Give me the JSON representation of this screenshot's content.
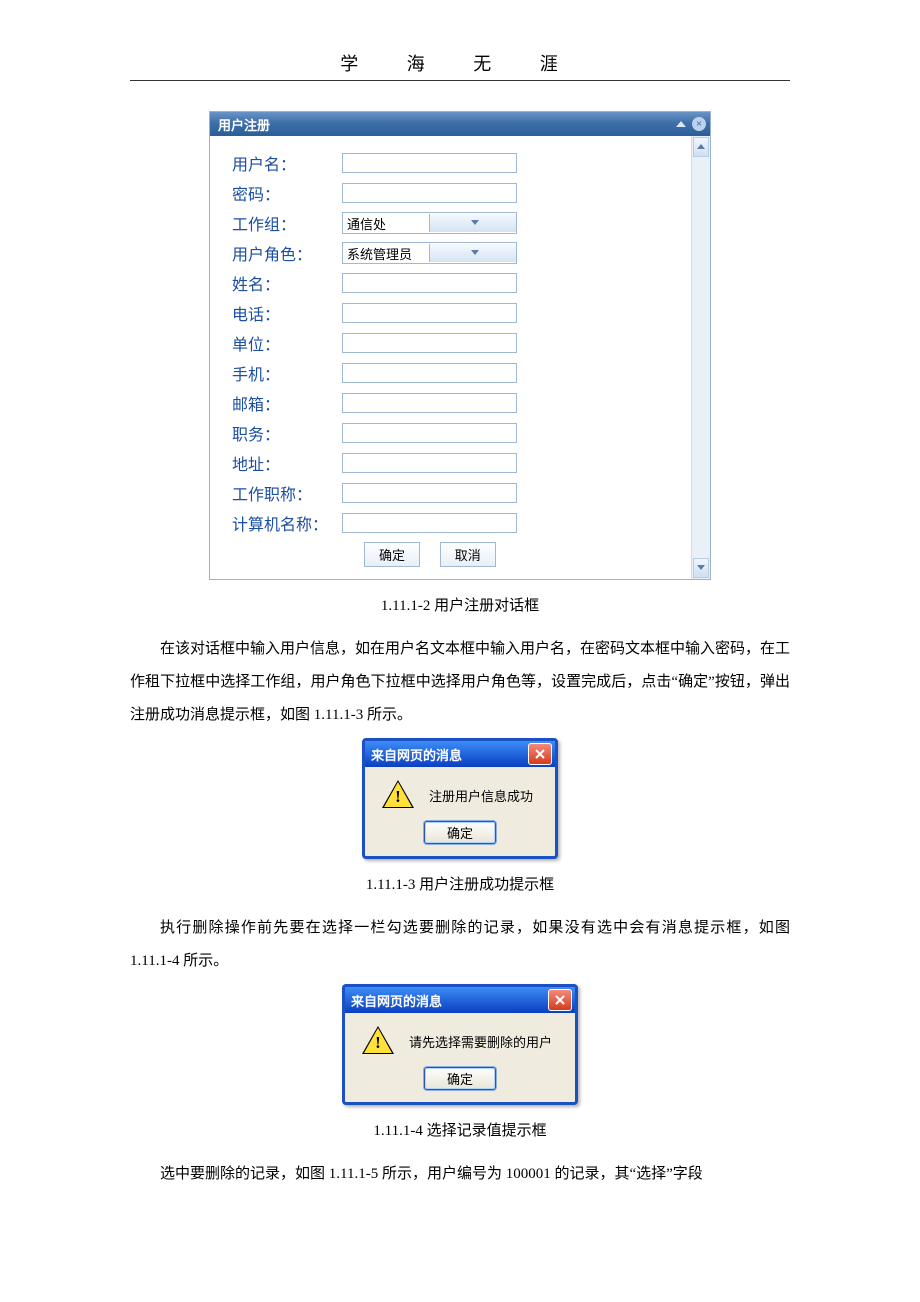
{
  "page_header": "学 海 无 涯",
  "dialog1": {
    "title": "用户注册",
    "fields": {
      "username": "用户名：",
      "password": "密码：",
      "workgroup": "工作组：",
      "workgroup_value": "通信处",
      "role": "用户角色：",
      "role_value": "系统管理员",
      "realname": "姓名：",
      "phone": "电话：",
      "unit": "单位：",
      "mobile": "手机：",
      "email": "邮箱：",
      "position": "职务：",
      "address": "地址：",
      "jobtitle": "工作职称：",
      "computer": "计算机名称："
    },
    "btn_ok": "确定",
    "btn_cancel": "取消"
  },
  "caption1": "1.11.1-2 用户注册对话框",
  "para1": "在该对话框中输入用户信息，如在用户名文本框中输入用户名，在密码文本框中输入密码，在工作租下拉框中选择工作组，用户角色下拉框中选择用户角色等，设置完成后，点击“确定”按钮，弹出注册成功消息提示框，如图 1.11.1-3 所示。",
  "msg1": {
    "title": "来自网页的消息",
    "text": "注册用户信息成功",
    "btn": "确定"
  },
  "caption2": "1.11.1-3 用户注册成功提示框",
  "para2": "执行删除操作前先要在选择一栏勾选要删除的记录，如果没有选中会有消息提示框，如图 1.11.1-4 所示。",
  "msg2": {
    "title": "来自网页的消息",
    "text": "请先选择需要删除的用户",
    "btn": "确定"
  },
  "caption3": "1.11.1-4 选择记录值提示框",
  "para3": "选中要删除的记录，如图 1.11.1-5 所示，用户编号为 100001 的记录，其“选择”字段"
}
